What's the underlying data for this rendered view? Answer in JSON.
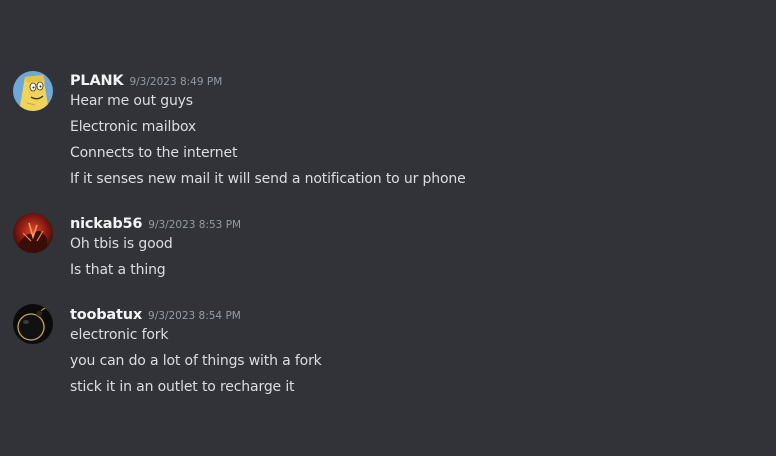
{
  "messages": [
    {
      "username": "PLANK",
      "timestamp": "9/3/2023 8:49 PM",
      "avatar_icon": "cartoon-plank-avatar",
      "lines": [
        "Hear me out guys",
        "Electronic mailbox",
        "Connects to the internet",
        "If it senses new mail it will send a notification to ur phone"
      ]
    },
    {
      "username": "nickab56",
      "timestamp": "9/3/2023 8:53 PM",
      "avatar_icon": "red-figure-avatar",
      "lines": [
        "Oh tbis is good",
        "Is that a thing"
      ]
    },
    {
      "username": "toobatux",
      "timestamp": "9/3/2023 8:54 PM",
      "avatar_icon": "bomb-avatar",
      "lines": [
        "electronic fork",
        "you can do a lot of things with a fork",
        "stick it in an outlet to recharge it"
      ]
    }
  ],
  "colors": {
    "background": "#313338",
    "username": "#f2f3f5",
    "timestamp": "#949ba4",
    "message_text": "#dbdee1"
  }
}
